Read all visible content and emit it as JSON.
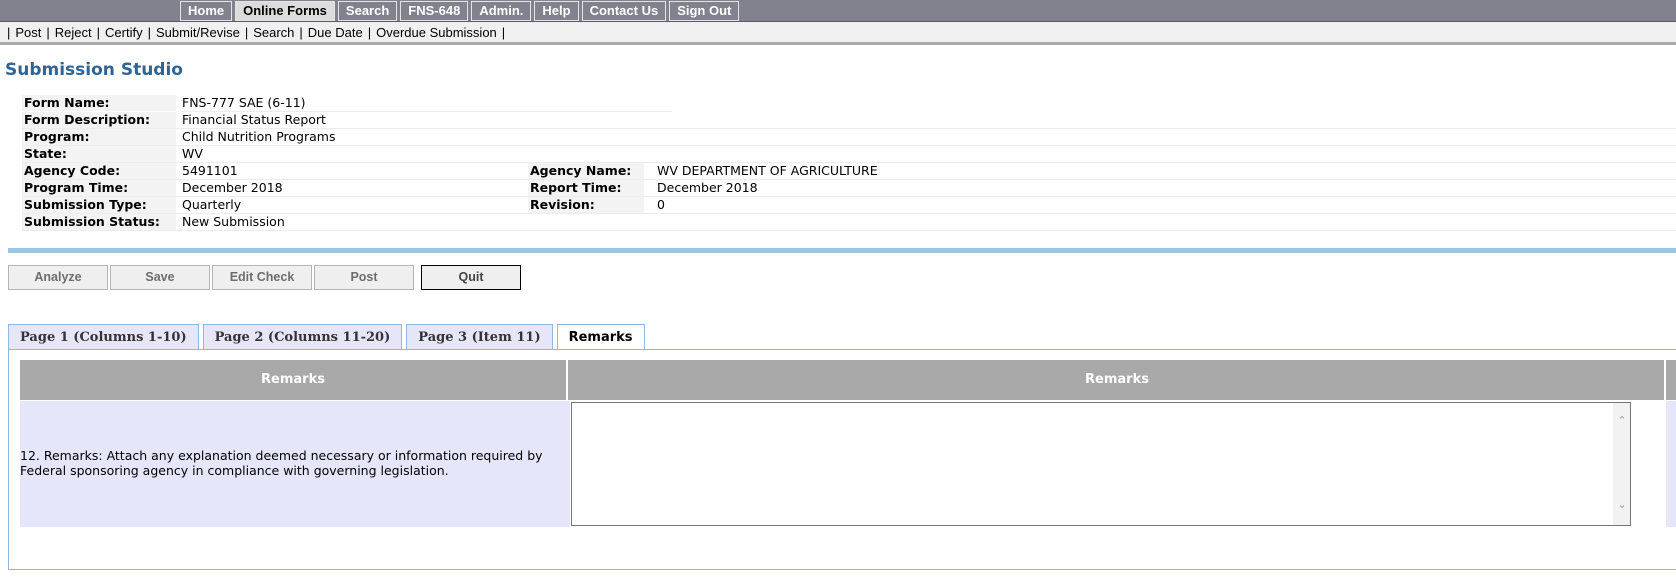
{
  "topnav": {
    "items": [
      {
        "label": "Home"
      },
      {
        "label": "Online Forms",
        "active": true
      },
      {
        "label": "Search"
      },
      {
        "label": "FNS-648"
      },
      {
        "label": "Admin."
      },
      {
        "label": "Help"
      },
      {
        "label": "Contact Us"
      },
      {
        "label": "Sign Out"
      }
    ]
  },
  "subnav": {
    "items": [
      "Post",
      "Reject",
      "Certify",
      "Submit/Revise",
      "Search",
      "Due Date",
      "Overdue Submission"
    ]
  },
  "page": {
    "title": "Submission Studio"
  },
  "info": {
    "form_name_label": "Form Name:",
    "form_name": "FNS-777 SAE (6-11)",
    "form_desc_label": "Form Description:",
    "form_desc": "Financial Status Report",
    "program_label": "Program:",
    "program": "Child Nutrition Programs",
    "state_label": "State:",
    "state": "WV",
    "agency_code_label": "Agency Code:",
    "agency_code": "5491101",
    "agency_name_label": "Agency Name:",
    "agency_name": "WV DEPARTMENT OF AGRICULTURE",
    "program_time_label": "Program Time:",
    "program_time": "December 2018",
    "report_time_label": "Report Time:",
    "report_time": "December 2018",
    "submission_type_label": "Submission Type:",
    "submission_type": "Quarterly",
    "revision_label": "Revision:",
    "revision": "0",
    "submission_status_label": "Submission Status:",
    "submission_status": "New Submission"
  },
  "actions": {
    "analyze": "Analyze",
    "save": "Save",
    "edit_check": "Edit Check",
    "post": "Post",
    "quit": "Quit"
  },
  "tabs": [
    {
      "label": "Page 1 (Columns 1-10)"
    },
    {
      "label": "Page 2 (Columns 11-20)"
    },
    {
      "label": "Page 3 (Item 11)"
    },
    {
      "label": "Remarks",
      "active": true
    }
  ],
  "remarks_table": {
    "header_1": "Remarks",
    "header_2": "Remarks",
    "row_description": "12. Remarks: Attach any explanation deemed necessary or information required by Federal sponsoring agency in compliance with governing legislation.",
    "textarea_value": ""
  },
  "colors": {
    "title": "#2e6496",
    "nav_bg": "#82828f",
    "tab_bg": "#e6e6fa",
    "header_bg": "#a9a9a9",
    "accent": "#9cc4e4"
  }
}
